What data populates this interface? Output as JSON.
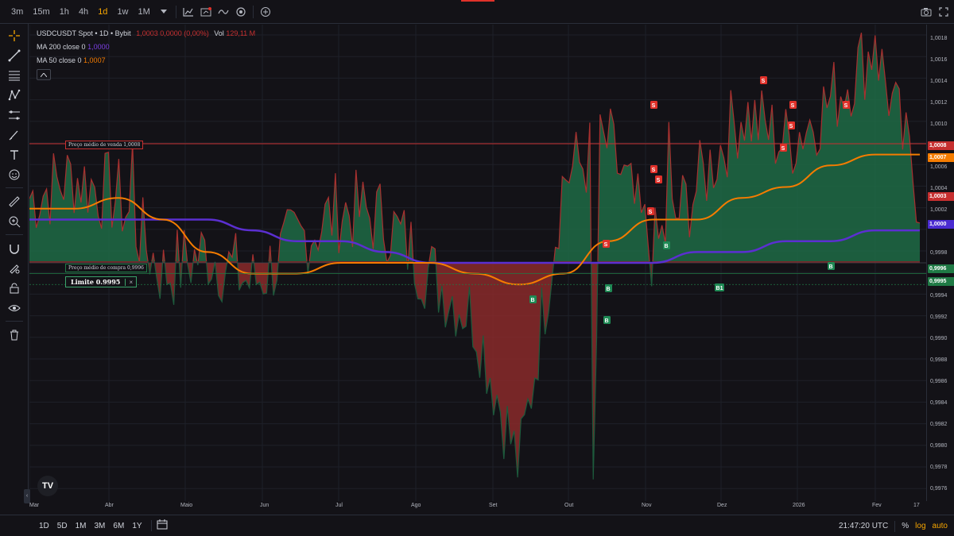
{
  "toolbar": {
    "timeframes": [
      "3m",
      "15m",
      "1h",
      "4h",
      "1d",
      "1w",
      "1M"
    ],
    "active_timeframe": "1d"
  },
  "legend": {
    "symbol_line": "USDCUSDT Spot • 1D • Bybit",
    "ohlc": "1,0003  0,0000 (0,00%)",
    "vol_label": "Vol",
    "vol_value": "129,11 M",
    "ma200_label": "MA 200 close 0",
    "ma200_value": "1,0000",
    "ma50_label": "MA 50 close 0",
    "ma50_value": "1,0007"
  },
  "annotations": {
    "sell_avg": "Preço médio de venda 1,0008",
    "buy_avg": "Preço médio de compra 0,9996",
    "limit_label": "Limite 0.9995",
    "limit_close": "×",
    "tv_logo": "TV"
  },
  "price_axis": {
    "ticks": [
      "1,0018",
      "1,0016",
      "1,0014",
      "1,0012",
      "1,0010",
      "1,0006",
      "1,0004",
      "1,0002",
      "0,9998",
      "0,9994",
      "0,9992",
      "0,9990",
      "0,9988",
      "0,9986",
      "0,9984",
      "0,9982",
      "0,9980",
      "0,9978",
      "0,9976"
    ],
    "badges": [
      {
        "text": "1,0008",
        "color": "#c62f2f"
      },
      {
        "text": "1,0007",
        "color": "#f57c00"
      },
      {
        "text": "1,0003",
        "color": "#c62f2f"
      },
      {
        "text": "1,0000",
        "color": "#4a2bd1"
      },
      {
        "text": "0,9996",
        "color": "#1f7a45"
      },
      {
        "text": "0,9995",
        "color": "#1f7a45"
      }
    ]
  },
  "time_axis": [
    "Mar",
    "Abr",
    "Maio",
    "Jun",
    "Jul",
    "Ago",
    "Set",
    "Out",
    "Nov",
    "Dez",
    "2026",
    "Fev",
    "17"
  ],
  "bottom": {
    "ranges": [
      "1D",
      "5D",
      "1M",
      "3M",
      "6M",
      "1Y"
    ],
    "time": "21:47:20 UTC",
    "percent": "%",
    "log": "log",
    "auto": "auto"
  },
  "markers": {
    "sell": "S",
    "buy": "B",
    "buy_b1": "B1"
  },
  "chart_data": {
    "type": "area",
    "title": "",
    "xlabel": "",
    "ylabel": "",
    "baseline": 0.9997,
    "ylim": [
      0.9975,
      1.0019
    ],
    "x_categories": [
      "Mar",
      "Abr",
      "Maio",
      "Jun",
      "Jul",
      "Ago",
      "Set",
      "Out",
      "Nov",
      "Dez",
      "2026",
      "Fev"
    ],
    "series": [
      {
        "name": "USDCUSDT Spot",
        "values": [
          1.0003,
          1.0005,
          1.0003,
          0.9996,
          0.9998,
          0.9995,
          0.9999,
          1.0002,
          1.0001,
          0.9996,
          0.9992,
          0.9978,
          1.0005,
          1.0008,
          0.9998,
          1.0004,
          1.0011,
          1.0008,
          1.0012,
          1.0017,
          1.0003
        ]
      },
      {
        "name": "MA 200 close 0",
        "values": [
          1.0001,
          1.0001,
          1.0001,
          1.0001,
          1.0001,
          1.0,
          0.9999,
          0.9999,
          0.9998,
          0.9997,
          0.9997,
          0.9997,
          0.9997,
          0.9997,
          0.9997,
          0.9998,
          0.9998,
          0.9999,
          0.9999,
          1.0,
          1.0
        ]
      },
      {
        "name": "MA 50 close 0",
        "values": [
          1.0002,
          1.0002,
          1.0003,
          1.0001,
          0.9998,
          0.9996,
          0.9996,
          0.9997,
          0.9997,
          0.9997,
          0.9996,
          0.9995,
          0.9996,
          0.9999,
          1.0001,
          1.0001,
          1.0003,
          1.0004,
          1.0006,
          1.0007,
          1.0007
        ]
      }
    ],
    "horizontal_lines": [
      {
        "label": "Preço médio de venda 1,0008",
        "value": 1.0008,
        "color": "#c62f2f"
      },
      {
        "label": "Preço médio de compra 0,9996",
        "value": 0.9996,
        "color": "#1f7a45"
      },
      {
        "label": "Limite 0.9995",
        "value": 0.9995,
        "color": "#1f7a45"
      }
    ]
  }
}
